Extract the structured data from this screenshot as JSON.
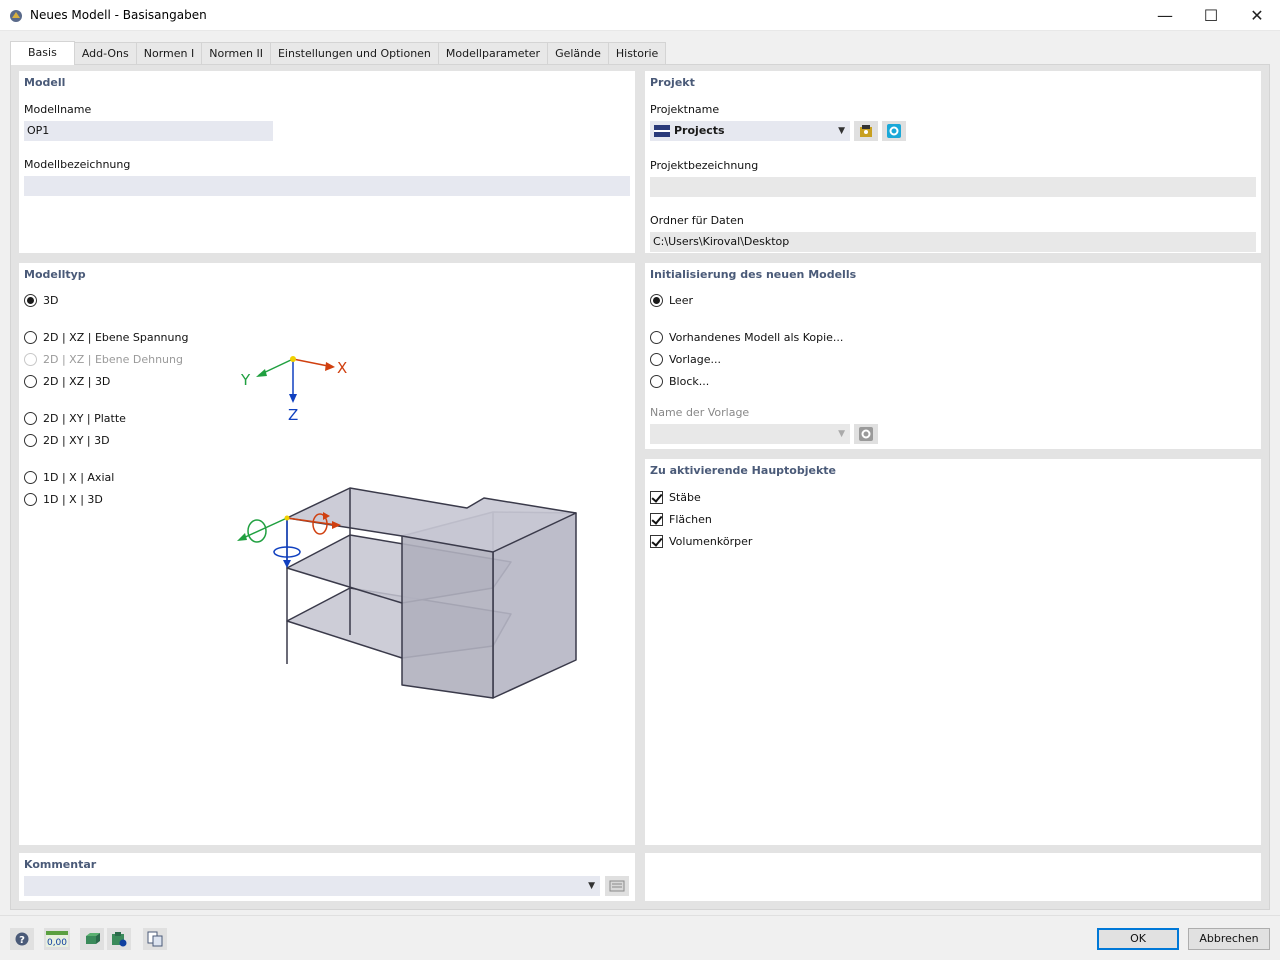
{
  "window": {
    "title": "Neues Modell - Basisangaben",
    "minimize": "—",
    "maximize": "☐",
    "close": "✕"
  },
  "tabs": [
    "Basis",
    "Add-Ons",
    "Normen I",
    "Normen II",
    "Einstellungen und Optionen",
    "Modellparameter",
    "Gelände",
    "Historie"
  ],
  "modell": {
    "title": "Modell",
    "name_label": "Modellname",
    "name_value": "OP1",
    "desc_label": "Modellbezeichnung",
    "desc_value": ""
  },
  "projekt": {
    "title": "Projekt",
    "name_label": "Projektname",
    "name_value": "Projects",
    "desc_label": "Projektbezeichnung",
    "desc_value": "",
    "folder_label": "Ordner für Daten",
    "folder_value": "C:\\Users\\Kiroval\\Desktop"
  },
  "modelltyp": {
    "title": "Modelltyp",
    "options": [
      {
        "label": "3D",
        "selected": true,
        "disabled": false
      },
      {
        "label": "2D | XZ | Ebene Spannung",
        "selected": false,
        "disabled": false
      },
      {
        "label": "2D | XZ | Ebene Dehnung",
        "selected": false,
        "disabled": true
      },
      {
        "label": "2D | XZ | 3D",
        "selected": false,
        "disabled": false
      },
      {
        "label": "2D | XY | Platte",
        "selected": false,
        "disabled": false
      },
      {
        "label": "2D | XY | 3D",
        "selected": false,
        "disabled": false
      },
      {
        "label": "1D | X | Axial",
        "selected": false,
        "disabled": false
      },
      {
        "label": "1D | X | 3D",
        "selected": false,
        "disabled": false
      }
    ],
    "axes": {
      "x": "X",
      "y": "Y",
      "z": "Z"
    }
  },
  "init": {
    "title": "Initialisierung des neuen Modells",
    "options": [
      {
        "label": "Leer",
        "selected": true
      },
      {
        "label": "Vorhandenes Modell als Kopie...",
        "selected": false
      },
      {
        "label": "Vorlage...",
        "selected": false
      },
      {
        "label": "Block...",
        "selected": false
      }
    ],
    "template_label": "Name der Vorlage",
    "template_value": ""
  },
  "hauptobjekte": {
    "title": "Zu aktivierende Hauptobjekte",
    "items": [
      {
        "label": "Stäbe",
        "checked": true
      },
      {
        "label": "Flächen",
        "checked": true
      },
      {
        "label": "Volumenkörper",
        "checked": true
      }
    ]
  },
  "kommentar": {
    "title": "Kommentar",
    "value": ""
  },
  "buttons": {
    "ok": "OK",
    "cancel": "Abbrechen"
  },
  "toolbar_icons": [
    "help-icon",
    "units-icon",
    "model-icon",
    "settings-icon",
    "copy-icon"
  ],
  "toolbar_units_text": "0,00",
  "colors": {
    "accent": "#0078d7",
    "panel_title": "#4a5a78",
    "axis_x": "#d04010",
    "axis_y": "#20a040",
    "axis_z": "#1040c0"
  }
}
